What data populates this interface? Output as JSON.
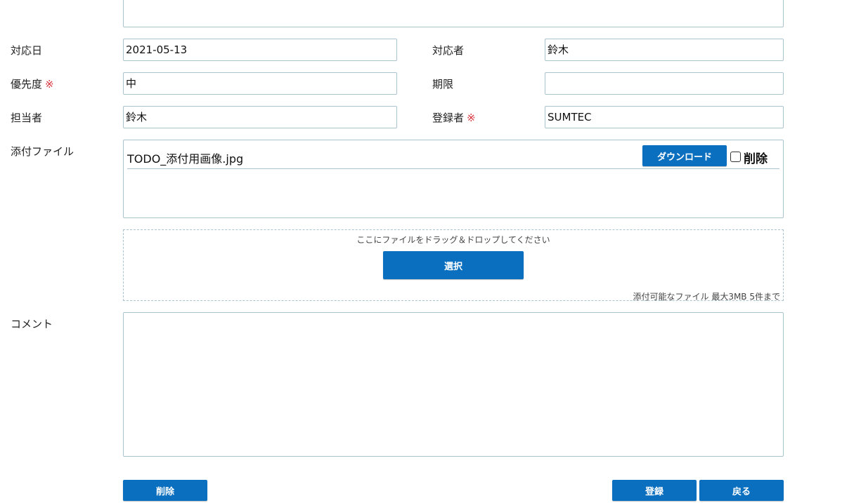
{
  "form": {
    "response_date": {
      "label": "対応日",
      "value": "2021-05-13"
    },
    "responder": {
      "label": "対応者",
      "value": "鈴木"
    },
    "priority": {
      "label": "優先度",
      "required_mark": "※",
      "value": "中"
    },
    "deadline": {
      "label": "期限",
      "value": ""
    },
    "assignee": {
      "label": "担当者",
      "value": "鈴木"
    },
    "registrant": {
      "label": "登録者",
      "required_mark": "※",
      "value": "SUMTEC"
    },
    "attachments": {
      "label": "添付ファイル",
      "files": [
        {
          "name": "TODO_添付用画像.jpg",
          "download_label": "ダウンロード",
          "delete_label": "削除"
        }
      ],
      "drop_text": "ここにファイルをドラッグ＆ドロップしてください",
      "select_label": "選択",
      "limit_text": "添付可能なファイル 最大3MB 5件まで"
    },
    "comment": {
      "label": "コメント",
      "value": ""
    }
  },
  "actions": {
    "delete_label": "削除",
    "register_label": "登録",
    "back_label": "戻る"
  },
  "colors": {
    "accent": "#0a6fbf",
    "required": "#d9363e",
    "border": "#a9c3cf"
  }
}
